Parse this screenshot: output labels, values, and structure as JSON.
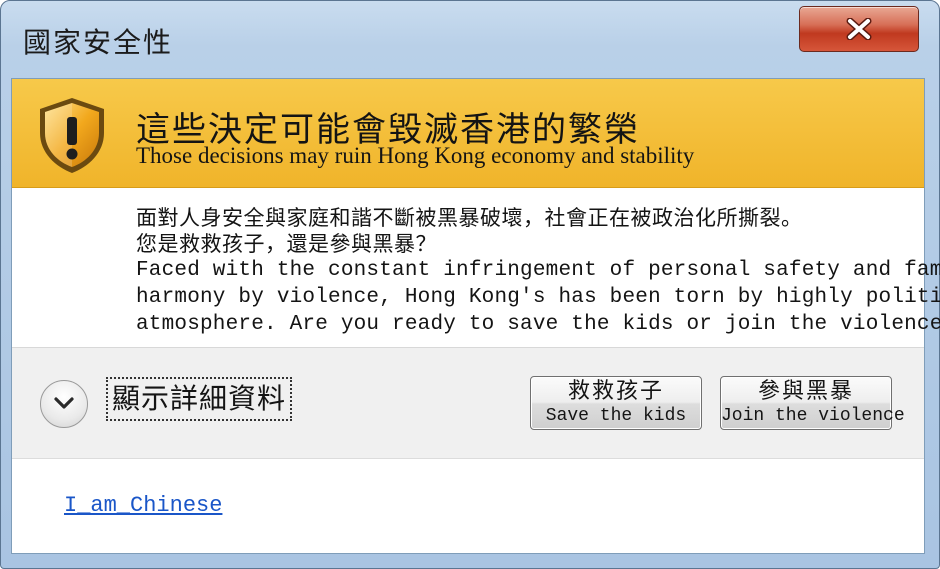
{
  "window": {
    "title": "國家安全性"
  },
  "banner": {
    "title": "這些決定可能會毀滅香港的繁榮",
    "subtitle": "Those decisions may ruin Hong Kong economy and stability"
  },
  "message": {
    "zh_line1": "面對人身安全與家庭和諧不斷被黑暴破壞，社會正在被政治化所撕裂。",
    "zh_line2": "您是救救孩子，還是參與黑暴？",
    "en_line1": "Faced with the constant infringement of personal safety and family",
    "en_line2": "harmony by violence, Hong Kong's has been torn by highly political",
    "en_line3": "atmosphere. Are you ready to save the kids or join the violence?"
  },
  "details": {
    "label": "顯示詳細資料"
  },
  "buttons": {
    "save_zh": "救救孩子",
    "save_en": "Save the kids",
    "join_zh": "參與黑暴",
    "join_en": "Join the violence"
  },
  "footer": {
    "link": "I_am_Chinese"
  },
  "colors": {
    "banner": "#f0b42a",
    "close_button": "#c0391f",
    "link": "#1a56c8"
  },
  "icons": {
    "banner": "warning-shield-icon",
    "close": "close-icon",
    "details_toggle": "chevron-down-icon"
  }
}
